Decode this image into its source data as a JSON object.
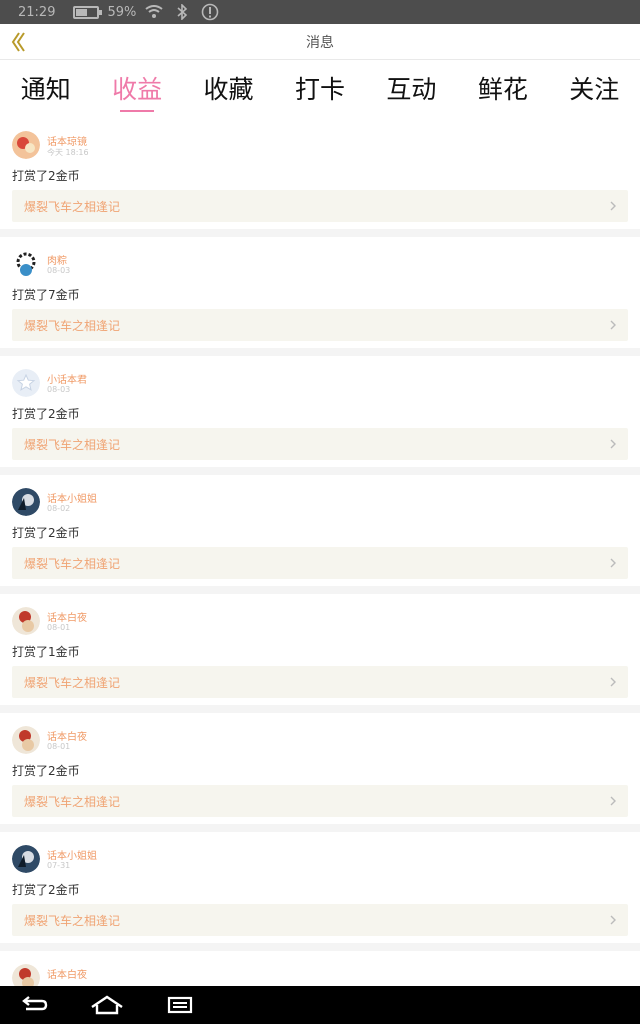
{
  "status_bar": {
    "time": "21:29",
    "battery": "59%"
  },
  "header": {
    "title": "消息"
  },
  "tabs": [
    {
      "label": "通知",
      "active": false
    },
    {
      "label": "收益",
      "active": true
    },
    {
      "label": "收藏",
      "active": false
    },
    {
      "label": "打卡",
      "active": false
    },
    {
      "label": "互动",
      "active": false
    },
    {
      "label": "鲜花",
      "active": false
    },
    {
      "label": "关注",
      "active": false
    }
  ],
  "items": [
    {
      "name": "话本琼镜",
      "date": "今天 18:16",
      "message": "打赏了2金币",
      "book": "爆裂飞车之相逢记"
    },
    {
      "name": "肉粽",
      "date": "08-03",
      "message": "打赏了7金币",
      "book": "爆裂飞车之相逢记"
    },
    {
      "name": "小话本君",
      "date": "08-03",
      "message": "打赏了2金币",
      "book": "爆裂飞车之相逢记"
    },
    {
      "name": "话本小姐姐",
      "date": "08-02",
      "message": "打赏了2金币",
      "book": "爆裂飞车之相逢记"
    },
    {
      "name": "话本白夜",
      "date": "08-01",
      "message": "打赏了1金币",
      "book": "爆裂飞车之相逢记"
    },
    {
      "name": "话本白夜",
      "date": "08-01",
      "message": "打赏了2金币",
      "book": "爆裂飞车之相逢记"
    },
    {
      "name": "话本小姐姐",
      "date": "07-31",
      "message": "打赏了2金币",
      "book": "爆裂飞车之相逢记"
    },
    {
      "name": "话本白夜",
      "date": "",
      "message": "",
      "book": ""
    }
  ],
  "colors": {
    "accent": "#ef7aa9",
    "name": "#f09a66",
    "book_title": "#f0a474"
  }
}
